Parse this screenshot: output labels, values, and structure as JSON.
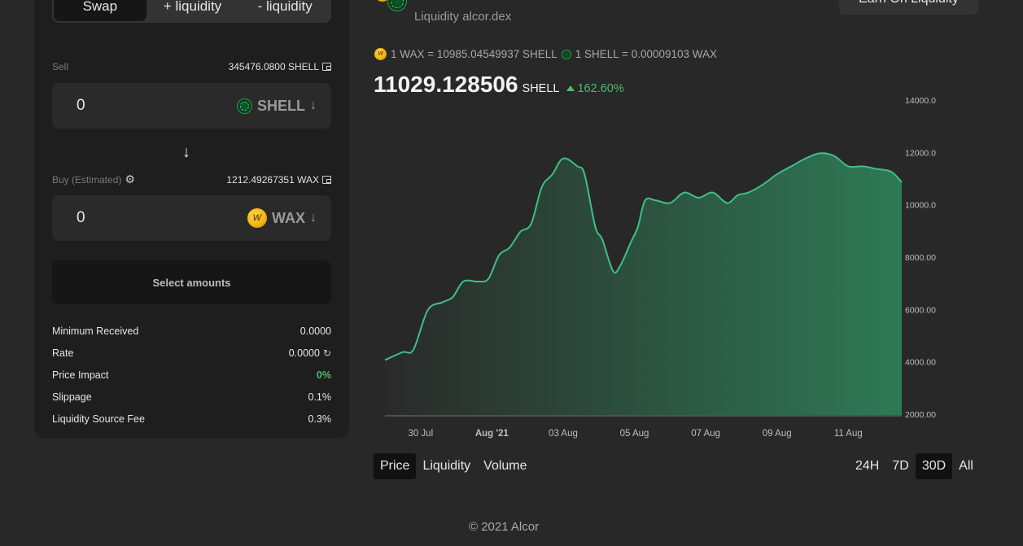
{
  "swap": {
    "tabs": [
      {
        "label": "Swap",
        "active": true
      },
      {
        "label": "+ liquidity",
        "active": false
      },
      {
        "label": "- liquidity",
        "active": false
      }
    ],
    "sell": {
      "label": "Sell",
      "balance": "345476.0800 SHELL",
      "amount": "0",
      "token": "SHELL",
      "token_icon": "shell-icon"
    },
    "buy": {
      "label": "Buy (Estimated)",
      "balance": "1212.49267351 WAX",
      "amount": "0",
      "token": "WAX",
      "token_icon": "wax-icon"
    },
    "select_button": "Select amounts",
    "details": [
      {
        "label": "Minimum Received",
        "value": "0.0000"
      },
      {
        "label": "Rate",
        "value": "0.0000"
      },
      {
        "label": "Price Impact",
        "value": "0%"
      },
      {
        "label": "Slippage",
        "value": "0.1%"
      },
      {
        "label": "Liquidity Source Fee",
        "value": "0.3%"
      }
    ]
  },
  "pair": {
    "subtitle": "Liquidity alcor.dex",
    "earn_button": "Earn On Liquidity",
    "rate_wax": "1 WAX = 10985.04549937 SHELL",
    "rate_shell": "1 SHELL = 0.00009103 WAX",
    "price": "11029.128506",
    "price_unit": "SHELL",
    "price_change": "162.60%"
  },
  "colors": {
    "accent_green": "#4dbb6a",
    "line": "#3fbf86",
    "fill": "#2e7a55",
    "background": "#282828"
  },
  "chart_data": {
    "type": "area",
    "y_ticks": [
      "14000.000000",
      "12000.000000",
      "10000.000000",
      "8000.000000",
      "6000.000000",
      "4000.000000",
      "2000.000000"
    ],
    "x_ticks": [
      {
        "label": "30 Jul",
        "pos": 1.5,
        "bold": false
      },
      {
        "label": "Aug '21",
        "pos": 3.5,
        "bold": true
      },
      {
        "label": "03 Aug",
        "pos": 5.5,
        "bold": false
      },
      {
        "label": "05 Aug",
        "pos": 7.5,
        "bold": false
      },
      {
        "label": "07 Aug",
        "pos": 9.5,
        "bold": false
      },
      {
        "label": "09 Aug",
        "pos": 11.5,
        "bold": false
      },
      {
        "label": "11 Aug",
        "pos": 13.5,
        "bold": false
      }
    ],
    "ylim": [
      2000,
      14000
    ],
    "xlim": [
      -1,
      13.5
    ],
    "grid": false,
    "series": [
      {
        "points": [
          [
            -1.0,
            4100
          ],
          [
            -0.5,
            4400
          ],
          [
            -0.2,
            4500
          ],
          [
            0.2,
            6000
          ],
          [
            0.6,
            6300
          ],
          [
            0.9,
            6500
          ],
          [
            1.2,
            7100
          ],
          [
            1.6,
            7100
          ],
          [
            1.9,
            7200
          ],
          [
            2.2,
            8100
          ],
          [
            2.5,
            8400
          ],
          [
            2.8,
            9000
          ],
          [
            3.1,
            9300
          ],
          [
            3.4,
            10700
          ],
          [
            3.7,
            11200
          ],
          [
            4.0,
            11800
          ],
          [
            4.4,
            11500
          ],
          [
            4.6,
            11200
          ],
          [
            4.9,
            9200
          ],
          [
            5.1,
            8700
          ],
          [
            5.4,
            7500
          ],
          [
            5.6,
            7700
          ],
          [
            5.9,
            8600
          ],
          [
            6.1,
            9200
          ],
          [
            6.3,
            10200
          ],
          [
            6.6,
            10200
          ],
          [
            7.0,
            10100
          ],
          [
            7.4,
            10500
          ],
          [
            7.8,
            10300
          ],
          [
            8.2,
            10500
          ],
          [
            8.6,
            10100
          ],
          [
            8.9,
            10400
          ],
          [
            9.2,
            10500
          ],
          [
            9.6,
            10800
          ],
          [
            10.0,
            11200
          ],
          [
            10.4,
            11500
          ],
          [
            10.8,
            11800
          ],
          [
            11.2,
            12000
          ],
          [
            11.6,
            11900
          ],
          [
            12.0,
            11500
          ],
          [
            12.4,
            11500
          ],
          [
            12.8,
            11400
          ],
          [
            13.2,
            11300
          ],
          [
            13.5,
            10900
          ]
        ]
      }
    ]
  },
  "chart_tabs": [
    {
      "label": "Price",
      "active": true
    },
    {
      "label": "Liquidity",
      "active": false
    },
    {
      "label": "Volume",
      "active": false
    }
  ],
  "range_tabs": [
    {
      "label": "24H",
      "active": false
    },
    {
      "label": "7D",
      "active": false
    },
    {
      "label": "30D",
      "active": true
    },
    {
      "label": "All",
      "active": false
    }
  ],
  "footer": "© 2021 Alcor"
}
